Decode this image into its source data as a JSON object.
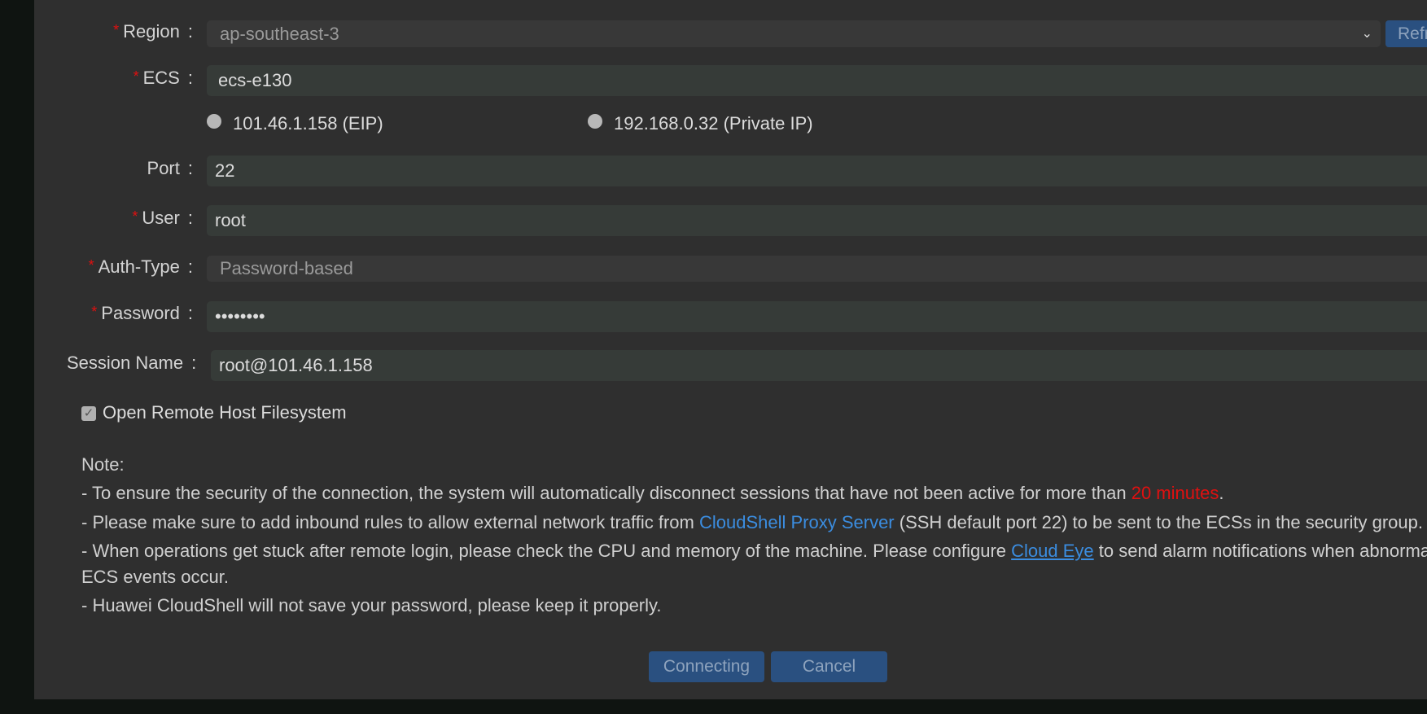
{
  "form": {
    "region": {
      "label": "Region",
      "value": "ap-southeast-3",
      "refresh_label": "Refr"
    },
    "ecs": {
      "label": "ECS",
      "value": "ecs-e130",
      "ip_options": [
        "101.46.1.158 (EIP)",
        "192.168.0.32 (Private IP)"
      ]
    },
    "port": {
      "label": "Port",
      "value": "22"
    },
    "user": {
      "label": "User",
      "value": "root"
    },
    "auth_type": {
      "label": "Auth-Type",
      "value": "Password-based"
    },
    "password": {
      "label": "Password",
      "value": "••••••••"
    },
    "session_name": {
      "label": "Session Name",
      "value": "root@101.46.1.158"
    },
    "open_fs": {
      "label": "Open Remote Host Filesystem",
      "checked": true
    },
    "colon": ":",
    "required_mark": "*"
  },
  "note": {
    "title": "Note:",
    "line1_a": "- To ensure the security of the connection, the system will automatically disconnect sessions that have not been active for more than ",
    "line1_red": "20 minutes",
    "line1_b": ".",
    "line2_a": "- Please make sure to add inbound rules to allow external network traffic from ",
    "line2_link": "CloudShell Proxy Server",
    "line2_b": " (SSH default port 22) to be sent to the ECSs in the security group.",
    "line3_a": "- When operations get stuck after remote login, please check the CPU and memory of the machine. Please configure ",
    "line3_link": "Cloud Eye",
    "line3_b": " to send alarm notifications when abnormal",
    "line3_c": "ECS events occur.",
    "line4": "- Huawei CloudShell will not save your password, please keep it properly."
  },
  "buttons": {
    "connecting": "Connecting",
    "cancel": "Cancel"
  }
}
